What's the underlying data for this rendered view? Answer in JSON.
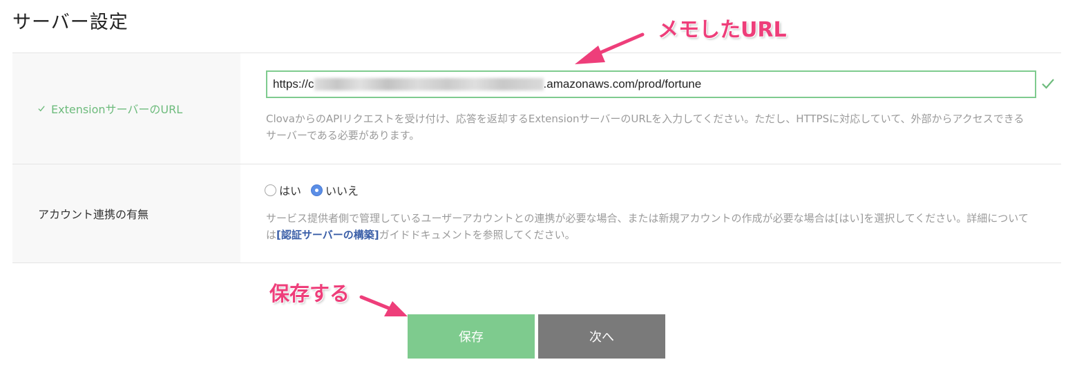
{
  "page": {
    "title": "サーバー設定"
  },
  "form": {
    "url_row": {
      "label": "ExtensionサーバーのURL",
      "url_prefix": "https://c",
      "url_suffix": ".amazonaws.com/prod/fortune",
      "help": "ClovaからのAPIリクエストを受け付け、応答を返却するExtensionサーバーのURLを入力してください。ただし、HTTPSに対応していて、外部からアクセスできるサーバーである必要があります。"
    },
    "account_row": {
      "label": "アカウント連携の有無",
      "options": [
        {
          "label": "はい",
          "checked": false
        },
        {
          "label": "いいえ",
          "checked": true
        }
      ],
      "help_before": "サービス提供者側で管理しているユーザーアカウントとの連携が必要な場合、または新規アカウントの作成が必要な場合は[はい]を選択してください。詳細については",
      "help_link": "[認証サーバーの構築]",
      "help_after": "ガイドドキュメントを参照してください。"
    }
  },
  "buttons": {
    "save_label": "保存",
    "next_label": "次へ"
  },
  "annotations": {
    "url_note": "メモしたURL",
    "save_note": "保存する"
  },
  "colors": {
    "valid_green": "#6dbb7c",
    "save_button": "#7ecb8e",
    "next_button": "#7a7a7a",
    "annotation_pink": "#ee3e7a",
    "radio_selected": "#5b8ee6",
    "link_blue": "#3b5fa8"
  },
  "icons": {
    "valid": "check-icon",
    "label_valid": "check-icon"
  }
}
